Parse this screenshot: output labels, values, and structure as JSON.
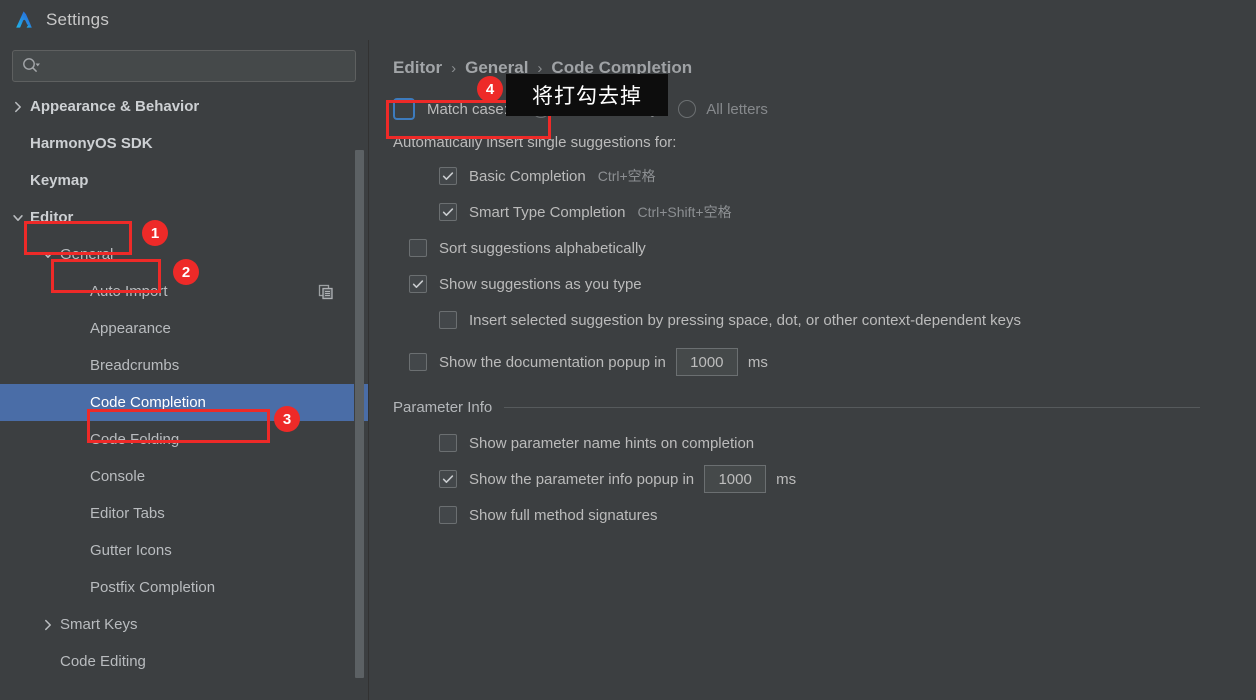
{
  "window": {
    "title": "Settings",
    "logo_icon": "deveco-logo-icon"
  },
  "sidebar": {
    "search": {
      "value": "",
      "placeholder": "",
      "icon": "search-icon"
    },
    "items": [
      {
        "label": "Appearance & Behavior",
        "level": 0,
        "arrow": "chevron-right",
        "bold": true,
        "selected": false,
        "trail_icon": ""
      },
      {
        "label": "HarmonyOS SDK",
        "level": 0,
        "arrow": "none",
        "bold": true,
        "selected": false,
        "trail_icon": ""
      },
      {
        "label": "Keymap",
        "level": 0,
        "arrow": "none",
        "bold": true,
        "selected": false,
        "trail_icon": ""
      },
      {
        "label": "Editor",
        "level": 0,
        "arrow": "chevron-down",
        "bold": true,
        "selected": false,
        "trail_icon": ""
      },
      {
        "label": "General",
        "level": 1,
        "arrow": "chevron-down",
        "bold": false,
        "selected": false,
        "trail_icon": ""
      },
      {
        "label": "Auto Import",
        "level": 2,
        "arrow": "none",
        "bold": false,
        "selected": false,
        "trail_icon": "copy-icon"
      },
      {
        "label": "Appearance",
        "level": 2,
        "arrow": "none",
        "bold": false,
        "selected": false,
        "trail_icon": ""
      },
      {
        "label": "Breadcrumbs",
        "level": 2,
        "arrow": "none",
        "bold": false,
        "selected": false,
        "trail_icon": ""
      },
      {
        "label": "Code Completion",
        "level": 2,
        "arrow": "none",
        "bold": false,
        "selected": true,
        "trail_icon": ""
      },
      {
        "label": "Code Folding",
        "level": 2,
        "arrow": "none",
        "bold": false,
        "selected": false,
        "trail_icon": ""
      },
      {
        "label": "Console",
        "level": 2,
        "arrow": "none",
        "bold": false,
        "selected": false,
        "trail_icon": ""
      },
      {
        "label": "Editor Tabs",
        "level": 2,
        "arrow": "none",
        "bold": false,
        "selected": false,
        "trail_icon": ""
      },
      {
        "label": "Gutter Icons",
        "level": 2,
        "arrow": "none",
        "bold": false,
        "selected": false,
        "trail_icon": ""
      },
      {
        "label": "Postfix Completion",
        "level": 2,
        "arrow": "none",
        "bold": false,
        "selected": false,
        "trail_icon": ""
      },
      {
        "label": "Smart Keys",
        "level": 1,
        "arrow": "chevron-right",
        "bold": false,
        "selected": false,
        "trail_icon": ""
      },
      {
        "label": "Code Editing",
        "level": 1,
        "arrow": "none",
        "bold": false,
        "selected": false,
        "trail_icon": ""
      }
    ]
  },
  "main": {
    "breadcrumb": {
      "crumb1": "Editor",
      "sep1": "›",
      "crumb2": "General",
      "sep2": "›",
      "crumb3": "Code Completion"
    },
    "match_case": {
      "label": "Match case:",
      "checked": false,
      "focused": true,
      "options": [
        {
          "label": "First letter only",
          "selected": true,
          "disabled": true
        },
        {
          "label": "All letters",
          "selected": false,
          "disabled": true
        }
      ]
    },
    "auto_insert_group_label": "Automatically insert single suggestions for:",
    "auto_insert_items": [
      {
        "label": "Basic Completion",
        "checked": true,
        "shortcut": "Ctrl+空格"
      },
      {
        "label": "Smart Type Completion",
        "checked": true,
        "shortcut": "Ctrl+Shift+空格"
      }
    ],
    "options": [
      {
        "label": "Sort suggestions alphabetically",
        "checked": false
      },
      {
        "label": "Show suggestions as you type",
        "checked": true
      }
    ],
    "insert_selected": {
      "label": "Insert selected suggestion by pressing space, dot, or other context-dependent keys",
      "checked": false
    },
    "doc_popup": {
      "label": "Show the documentation popup in",
      "checked": false,
      "value": "1000",
      "unit": "ms"
    },
    "parameter_info": {
      "section_title": "Parameter Info",
      "items": [
        {
          "label": "Show parameter name hints on completion",
          "checked": false,
          "value": "",
          "unit": ""
        },
        {
          "label": "Show the parameter info popup in",
          "checked": true,
          "value": "1000",
          "unit": "ms"
        },
        {
          "label": "Show full method signatures",
          "checked": false,
          "value": "",
          "unit": ""
        }
      ]
    }
  },
  "annotations": {
    "tooltip_text": "将打勾去掉",
    "accent_color": "#ee2a28",
    "markers": [
      {
        "number": "1"
      },
      {
        "number": "2"
      },
      {
        "number": "3"
      },
      {
        "number": "4"
      }
    ]
  }
}
